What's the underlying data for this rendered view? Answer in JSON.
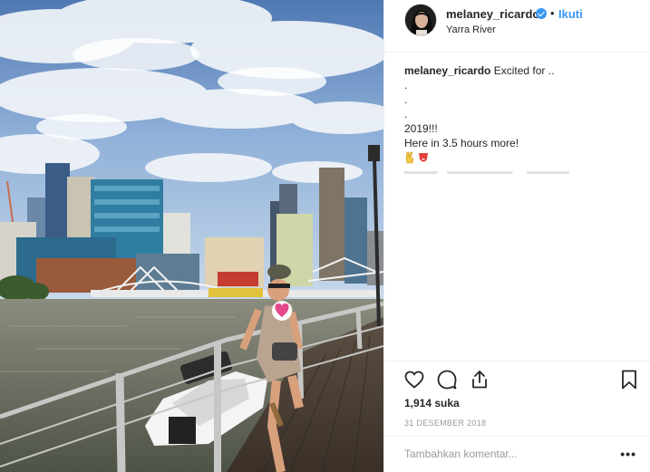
{
  "header": {
    "username": "melaney_ricardo",
    "separator": "•",
    "follow_label": "Ikuti",
    "location": "Yarra River"
  },
  "caption": {
    "username": "melaney_ricardo",
    "text": "Excited for ..",
    "lines": [
      ".",
      ".",
      ".",
      "2019!!!",
      "Here in 3.5 hours more!"
    ],
    "emojis": [
      "victory-hand-icon",
      "tongue-face-icon"
    ]
  },
  "actions": {
    "like_icon": "heart-outline-icon",
    "comment_icon": "speech-bubble-icon",
    "share_icon": "share-icon",
    "save_icon": "bookmark-icon"
  },
  "stats": {
    "likes": "1,914 suka",
    "date": "31 DESEMBER 2018"
  },
  "comment_box": {
    "placeholder": "Tambahkan komentar...",
    "more_label": "•••"
  },
  "colors": {
    "accent": "#3897f0",
    "text": "#262626",
    "muted": "#999999",
    "divider": "#efefef"
  }
}
